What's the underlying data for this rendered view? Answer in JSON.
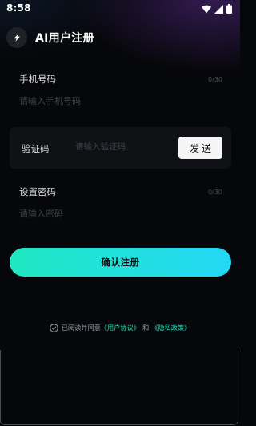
{
  "status_bar": {
    "time": "8:58",
    "icons": [
      "wifi-icon",
      "signal-icon",
      "battery-icon"
    ]
  },
  "header": {
    "title": "AI用户注册",
    "logo_icon": "lightning-bolt-icon"
  },
  "phone": {
    "label": "手机号码",
    "counter": "0/30",
    "placeholder": "请输入手机号码",
    "value": ""
  },
  "verify": {
    "label": "验证码",
    "placeholder": "请输入验证码",
    "value": "",
    "send_label": "发送"
  },
  "password": {
    "label": "设置密码",
    "counter": "0/30",
    "placeholder": "请输入密码",
    "value": ""
  },
  "confirm_label": "确认注册",
  "agreement": {
    "prefix": "已阅读并同意",
    "user_agreement": "《用户协议》",
    "and": "和",
    "privacy_policy": "《隐私政策》"
  },
  "colors": {
    "background": "#06070a",
    "accent_start": "#1fe8c0",
    "accent_end": "#23d7f4",
    "link": "#26d9b8"
  }
}
